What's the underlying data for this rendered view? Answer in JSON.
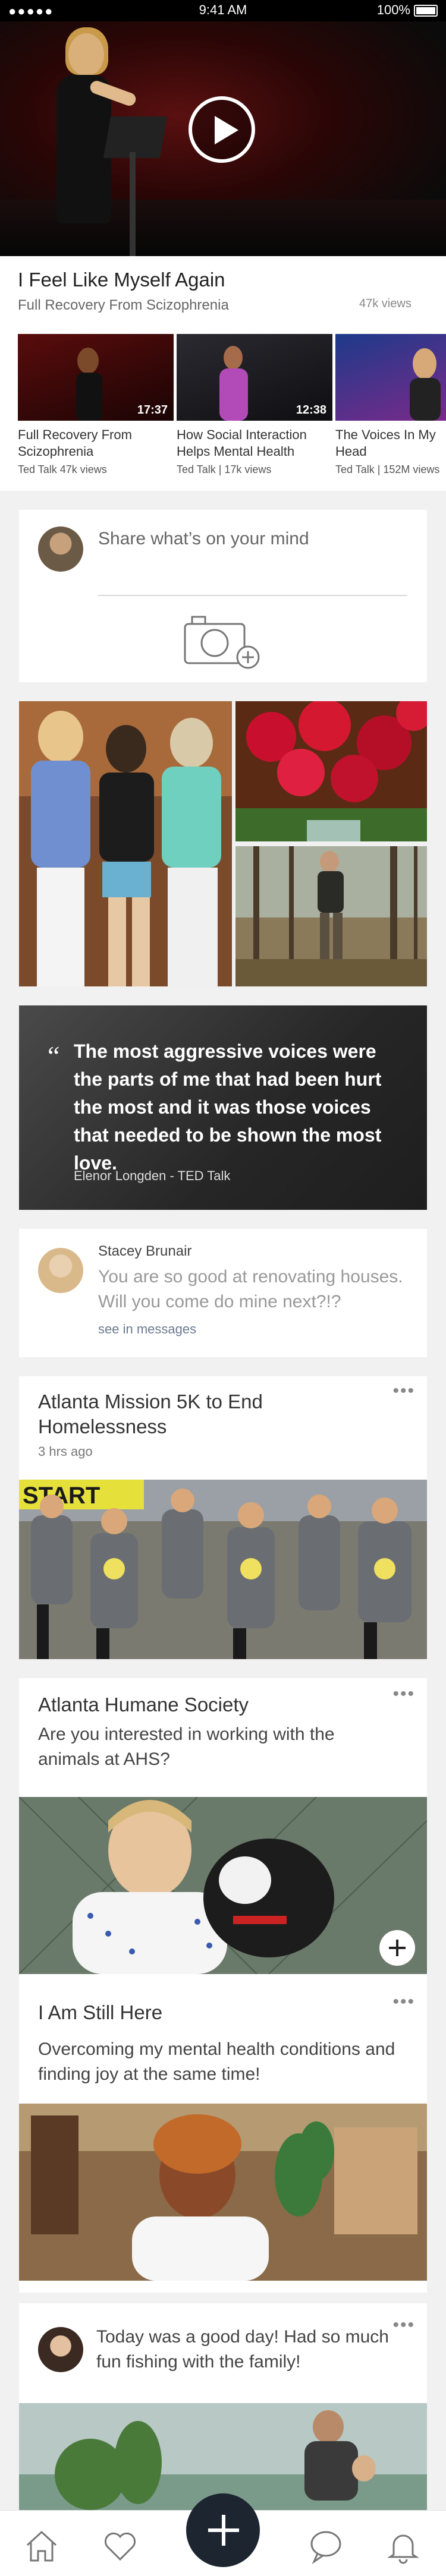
{
  "status_bar": {
    "signal": "●●●●●",
    "time": "9:41 AM",
    "battery": "100%"
  },
  "featured": {
    "title": "I Feel Like Myself Again",
    "subtitle": "Full Recovery From Scizophrenia",
    "views": "47k views"
  },
  "videos": [
    {
      "title": "Full Recovery From Scizophrenia",
      "meta": "Ted Talk   47k views",
      "duration": "17:37"
    },
    {
      "title": "How Social Interaction Helps Mental Health",
      "meta": "Ted Talk  |  17k views",
      "duration": "12:38"
    },
    {
      "title": "The Voices In My Head",
      "meta": "Ted Talk  |  152M views",
      "duration": ""
    }
  ],
  "composer": {
    "placeholder": "Share what’s on your mind"
  },
  "quote": {
    "mark": "“",
    "text": "The most aggressive voices were the parts of me that had been hurt the most and it was those voices that needed to be shown the most love.",
    "attribution": "Elenor Longden - TED Talk"
  },
  "message": {
    "sender": "Stacey Brunair",
    "text": "You are so good at renovating houses. Will you come do mine next?!?",
    "link": "see in messages"
  },
  "posts": [
    {
      "title": "Atlanta Mission 5K to End Homelessness",
      "time": "3 hrs ago",
      "more": "•••",
      "image_text": "START"
    },
    {
      "title": "Atlanta Humane Society",
      "body": "Are you interested in working with the animals at AHS?",
      "more": "•••"
    },
    {
      "title": "I Am Still Here",
      "body": "Overcoming my mental health conditions and finding joy at the same time!",
      "more": "•••"
    },
    {
      "body": "Today was a good day! Had so much fun fishing with the family!",
      "more": "•••"
    }
  ],
  "colors": {
    "fab": "#1c2530",
    "link": "#6b7a90"
  },
  "icons": [
    "home-icon",
    "heart-icon",
    "plus-icon",
    "chat-bubble-icon",
    "bell-icon",
    "camera-add-icon",
    "play-icon"
  ]
}
